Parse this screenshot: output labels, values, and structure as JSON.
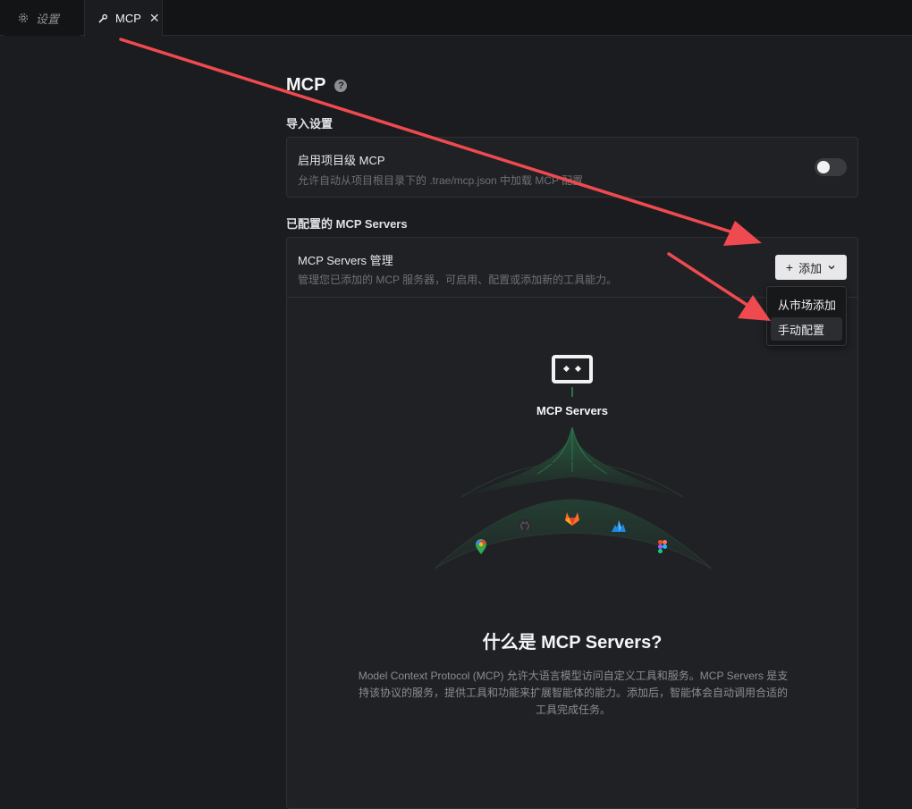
{
  "tabs": [
    {
      "label": "设置",
      "icon": "gear-icon",
      "active": false
    },
    {
      "label": "MCP",
      "icon": "wrench-icon",
      "active": true
    }
  ],
  "page": {
    "title": "MCP",
    "help": "?"
  },
  "import_settings": {
    "section_title": "导入设置",
    "card_title": "启用项目级 MCP",
    "card_desc": "允许自动从项目根目录下的 .trae/mcp.json 中加载 MCP 配置",
    "toggle_on": false
  },
  "servers": {
    "section_title": "已配置的 MCP Servers",
    "card_title": "MCP Servers 管理",
    "card_desc": "管理您已添加的 MCP 服务器，可启用、配置或添加新的工具能力。",
    "add_button": {
      "plus": "+",
      "label": "添加"
    },
    "dropdown": [
      "从市场添加",
      "手动配置"
    ],
    "illustration_label": "MCP Servers",
    "what_title": "什么是 MCP Servers?",
    "what_desc": "Model Context Protocol (MCP) 允许大语言模型访问自定义工具和服务。MCP Servers 是支持该协议的服务，提供工具和功能来扩展智能体的能力。添加后，智能体会自动调用合适的工具完成任务。"
  },
  "colors": {
    "background": "#1b1c1f",
    "card": "#202124",
    "annotation_arrow": "#ef4a4f",
    "accent_green": "#2e8b57"
  },
  "integration_icons": [
    "google-maps-icon",
    "github-icon",
    "gitlab-icon",
    "azure-icon",
    "figma-icon"
  ]
}
